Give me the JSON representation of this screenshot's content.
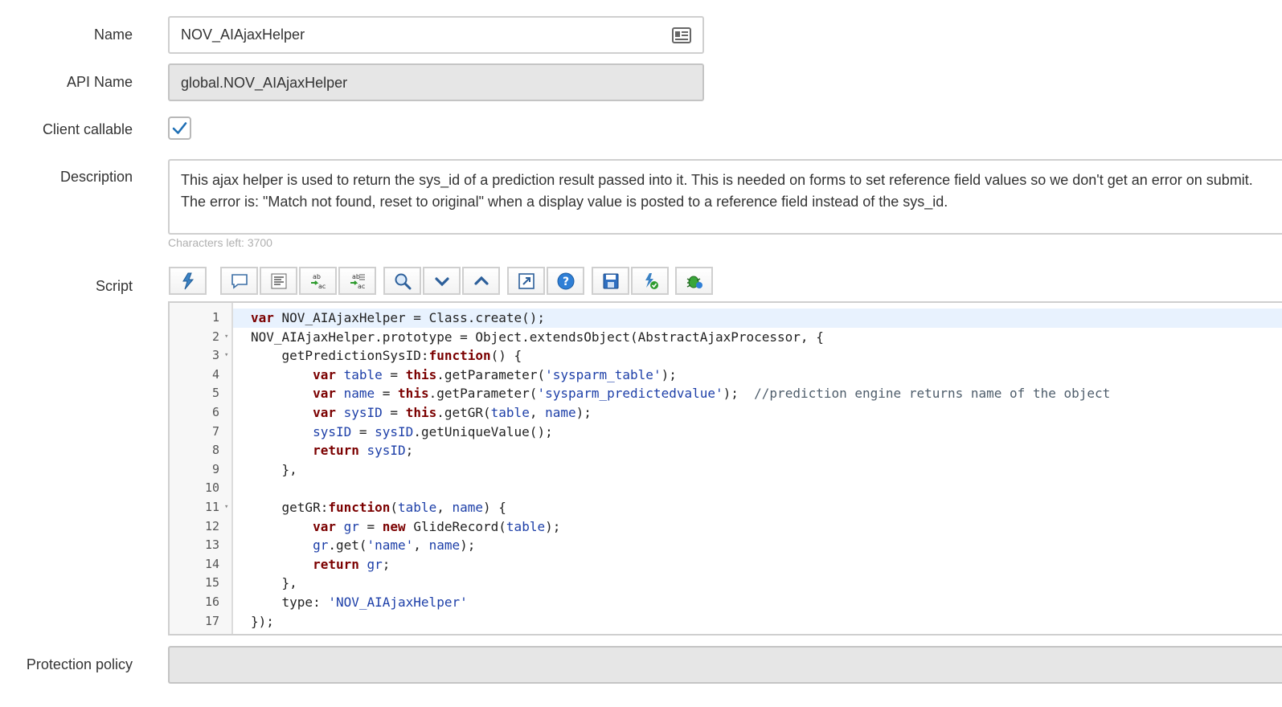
{
  "form": {
    "name": {
      "label": "Name",
      "value": "NOV_AIAjaxHelper"
    },
    "api_name": {
      "label": "API Name",
      "value": "global.NOV_AIAjaxHelper"
    },
    "client_callable": {
      "label": "Client callable",
      "checked": true
    },
    "description": {
      "label": "Description",
      "value": "This ajax helper is used to return the sys_id of a prediction result passed into it. This is needed on forms to set reference field values so we don't get an error on submit.\nThe error is: \"Match not found, reset to original\" when a display value is posted to a reference field instead of the sys_id.",
      "chars_left": "Characters left: 3700"
    },
    "script": {
      "label": "Script",
      "toolbar_icons": [
        "toggle-syntax-icon",
        "comment-icon",
        "format-code-icon",
        "replace-icon",
        "replace-all-icon",
        "search-icon",
        "next-icon",
        "previous-icon",
        "fullscreen-icon",
        "help-icon",
        "save-icon",
        "check-script-icon",
        "debug-icon"
      ],
      "line_numbers": [
        "1",
        "2",
        "3",
        "4",
        "5",
        "6",
        "7",
        "8",
        "9",
        "10",
        "11",
        "12",
        "13",
        "14",
        "15",
        "16",
        "17"
      ],
      "lines": [
        "var NOV_AIAjaxHelper = Class.create();",
        "NOV_AIAjaxHelper.prototype = Object.extendsObject(AbstractAjaxProcessor, {",
        "    getPredictionSysID:function() {",
        "        var table = this.getParameter('sysparm_table');",
        "        var name = this.getParameter('sysparm_predictedvalue');  //prediction engine returns name of the object",
        "        var sysID = this.getGR(table, name);",
        "        sysID = sysID.getUniqueValue();",
        "        return sysID;",
        "    },",
        "",
        "    getGR:function(table, name) {",
        "        var gr = new GlideRecord(table);",
        "        gr.get('name', name);",
        "        return gr;",
        "    },",
        "    type: 'NOV_AIAjaxHelper'",
        "});"
      ]
    },
    "protection_policy": {
      "label": "Protection policy",
      "value": ""
    }
  },
  "colors": {
    "accent": "#1f6fb5",
    "field_border": "#cfcfcf",
    "readonly_bg": "#e6e6e6"
  }
}
